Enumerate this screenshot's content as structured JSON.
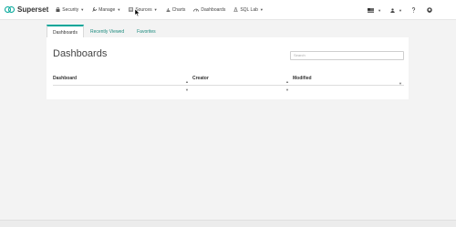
{
  "brand": {
    "name": "Superset",
    "accent": "#00a699"
  },
  "nav": {
    "items": [
      {
        "label": "Security",
        "icon": "lock-icon",
        "dropdown": true
      },
      {
        "label": "Manage",
        "icon": "wrench-icon",
        "dropdown": true
      },
      {
        "label": "Sources",
        "icon": "database-icon",
        "dropdown": true
      },
      {
        "label": "Charts",
        "icon": "bar-chart-icon",
        "dropdown": false
      },
      {
        "label": "Dashboards",
        "icon": "dashboard-icon",
        "dropdown": false
      },
      {
        "label": "SQL Lab",
        "icon": "flask-icon",
        "dropdown": true
      }
    ],
    "right": [
      "flag-icon",
      "user-icon",
      "question-icon",
      "github-icon"
    ]
  },
  "tabs": [
    "Dashboards",
    "Recently Viewed",
    "Favorites"
  ],
  "page": {
    "title": "Dashboards",
    "search_placeholder": "Search"
  },
  "table": {
    "columns": [
      "Dashboard",
      "Creator",
      "Modified"
    ]
  }
}
